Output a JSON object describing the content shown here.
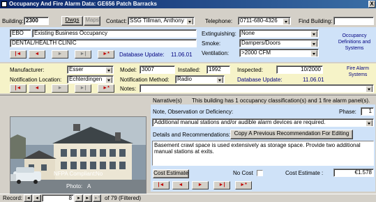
{
  "window": {
    "title": "Occupancy And Fire Alarm Data:  GE656  Patch Barracks",
    "close_label": "X"
  },
  "top": {
    "building_label": "Building:",
    "building_value": "2300",
    "dwgs_label": "Dwgs",
    "maps_label": "Maps",
    "contact_label": "Contact:",
    "contact_value": "SSG Tillman, Anthony",
    "telephone_label": "Telephone:",
    "telephone_value": "0711-680-4326",
    "find_label": "Find Building:",
    "find_value": ""
  },
  "occupancy": {
    "code": "EBO",
    "description": "Existing Business Occupancy",
    "use": "DENTAL/HEALTH CLINIC",
    "extinguishing_label": "Extinguishing:",
    "extinguishing_value": "None",
    "smoke_label": "Smoke:",
    "smoke_value": "Dampers/Doors",
    "ventilation_label": "Ventilation:",
    "ventilation_value": ">2000 CFM",
    "database_update_label": "Database Update:",
    "database_update_value": "11.06.01",
    "side_label": "Occupancy Definitions and Systems"
  },
  "alarm": {
    "manufacturer_label": "Manufacturer:",
    "manufacturer_value": "Esser",
    "model_label": "Model:",
    "model_value": "3007",
    "installed_label": "Installed:",
    "installed_value": "1992",
    "inspected_label": "Inspected:",
    "inspected_value": "10/2000",
    "notif_location_label": "Notification Location:",
    "notif_location_value": "Echterdingen",
    "notif_method_label": "Notification Method:",
    "notif_method_value": "Radio",
    "database_update_label": "Database Update:",
    "database_update_value": "11.06.01",
    "notes_label": "Notes:",
    "notes_value": "",
    "side_label": "Fire Alarm Systems"
  },
  "nav_buttons": {
    "first": "|◄",
    "prev": "◄",
    "next": "►",
    "last": "►|",
    "new": "►*"
  },
  "photo": {
    "nfpa_label": "NFPA Compliant:",
    "nfpa_value": "No",
    "photo_label": "Photo:",
    "photo_value": "A"
  },
  "narrative": {
    "label": "Narrative(s)",
    "text": "This building has 1 occupancy classification(s) and 1 fire alarm panel(s).",
    "note_label": "Note, Observation or Deficiency:",
    "phase_label": "Phase:",
    "phase_value": "1",
    "note_value": "Additional manual stations and/or audible alarm devices are required.",
    "details_label": "Details and Recommendations:",
    "copy_button": "Copy A Previous Recommendation For Editing",
    "details_value": "Basement crawl space is used extensively as storage space. Provide two additional manual stations at exits.",
    "cost_estimate_button": "Cost Estimate",
    "no_cost_label": "No Cost",
    "cost_estimate_label": "Cost Estimate :",
    "cost_estimate_value": "€1.578"
  },
  "record": {
    "label": "Record:",
    "current": "8",
    "of_text": "of  79 (Filtered)"
  }
}
